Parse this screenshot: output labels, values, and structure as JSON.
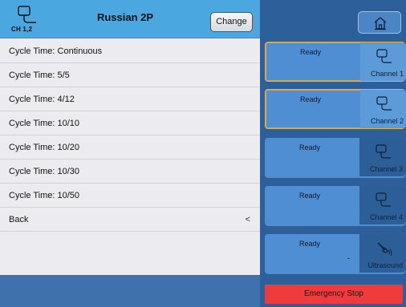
{
  "header": {
    "channel_label": "CH 1,2",
    "title": "Russian 2P",
    "change_label": "Change"
  },
  "menu": {
    "items": [
      {
        "label": "Cycle Time: Continuous"
      },
      {
        "label": "Cycle Time: 5/5"
      },
      {
        "label": "Cycle Time: 4/12"
      },
      {
        "label": "Cycle Time: 10/10"
      },
      {
        "label": "Cycle Time: 10/20"
      },
      {
        "label": "Cycle Time: 10/30"
      },
      {
        "label": "Cycle Time: 10/50"
      }
    ],
    "back_label": "Back",
    "back_chevron": "<"
  },
  "channels": [
    {
      "status": "Ready",
      "label": "Channel 1",
      "selected": true,
      "icon": "electrode-icon"
    },
    {
      "status": "Ready",
      "label": "Channel 2",
      "selected": true,
      "icon": "electrode-icon"
    },
    {
      "status": "Ready",
      "label": "Channel 3",
      "selected": false,
      "icon": "electrode-icon"
    },
    {
      "status": "Ready",
      "label": "Channel 4",
      "selected": false,
      "icon": "electrode-icon"
    },
    {
      "status": "Ready",
      "label": "Ultrasound",
      "selected": false,
      "icon": "ultrasound-icon",
      "extra": "-"
    }
  ],
  "emergency_stop_label": "Emergency Stop",
  "colors": {
    "header_blue": "#4aa7e0",
    "panel_blue": "#2d5f9a",
    "card_blue": "#4f8ed3",
    "selected_border": "#e3b04b",
    "emergency_red": "#ef3b3b"
  }
}
